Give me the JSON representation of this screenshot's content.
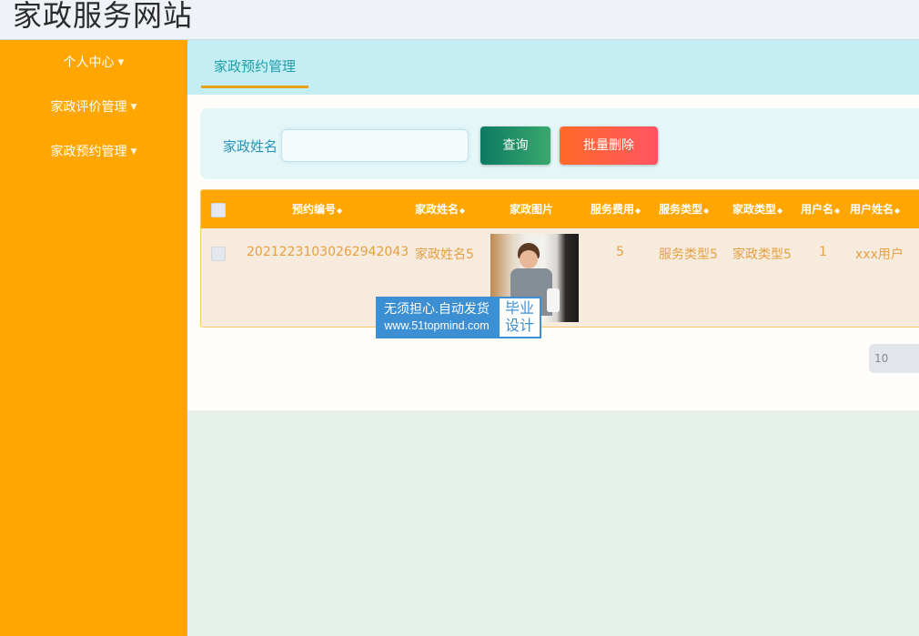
{
  "header": {
    "site_title": "家政服务网站"
  },
  "sidebar": {
    "items": [
      {
        "label": "个人中心"
      },
      {
        "label": "家政评价管理"
      },
      {
        "label": "家政预约管理"
      }
    ]
  },
  "tabs": [
    {
      "label": "家政预约管理"
    }
  ],
  "search": {
    "label": "家政姓名",
    "value": "",
    "placeholder": "",
    "query_button": "查询",
    "batch_delete_button": "批量删除"
  },
  "table": {
    "columns": [
      "预约编号",
      "家政姓名",
      "家政图片",
      "服务费用",
      "服务类型",
      "家政类型",
      "用户名",
      "用户姓名"
    ],
    "rows": [
      {
        "order_no": "20212231030262942043",
        "name": "家政姓名5",
        "image": "housekeeper-photo",
        "fee": "5",
        "service_type": "服务类型5",
        "housekeeping_type": "家政类型5",
        "username": "1",
        "user_fullname": "xxx用户"
      }
    ]
  },
  "watermark": {
    "line1": "无须担心.自动发货",
    "line2": "www.51topmind.com",
    "side1": "毕业",
    "side2": "设计"
  },
  "pagination": {
    "page_size": "10"
  },
  "icons": {
    "caret": "caret-down-icon",
    "sort": "sort-icon",
    "checkbox": "checkbox-icon"
  },
  "colors": {
    "sidebar": "#ffa600",
    "table_header": "#ffa600",
    "tab_bar": "#c4eef4",
    "query_button": "#1a8a66",
    "delete_button": "#ff5c4a",
    "row_text": "#e6a042"
  }
}
